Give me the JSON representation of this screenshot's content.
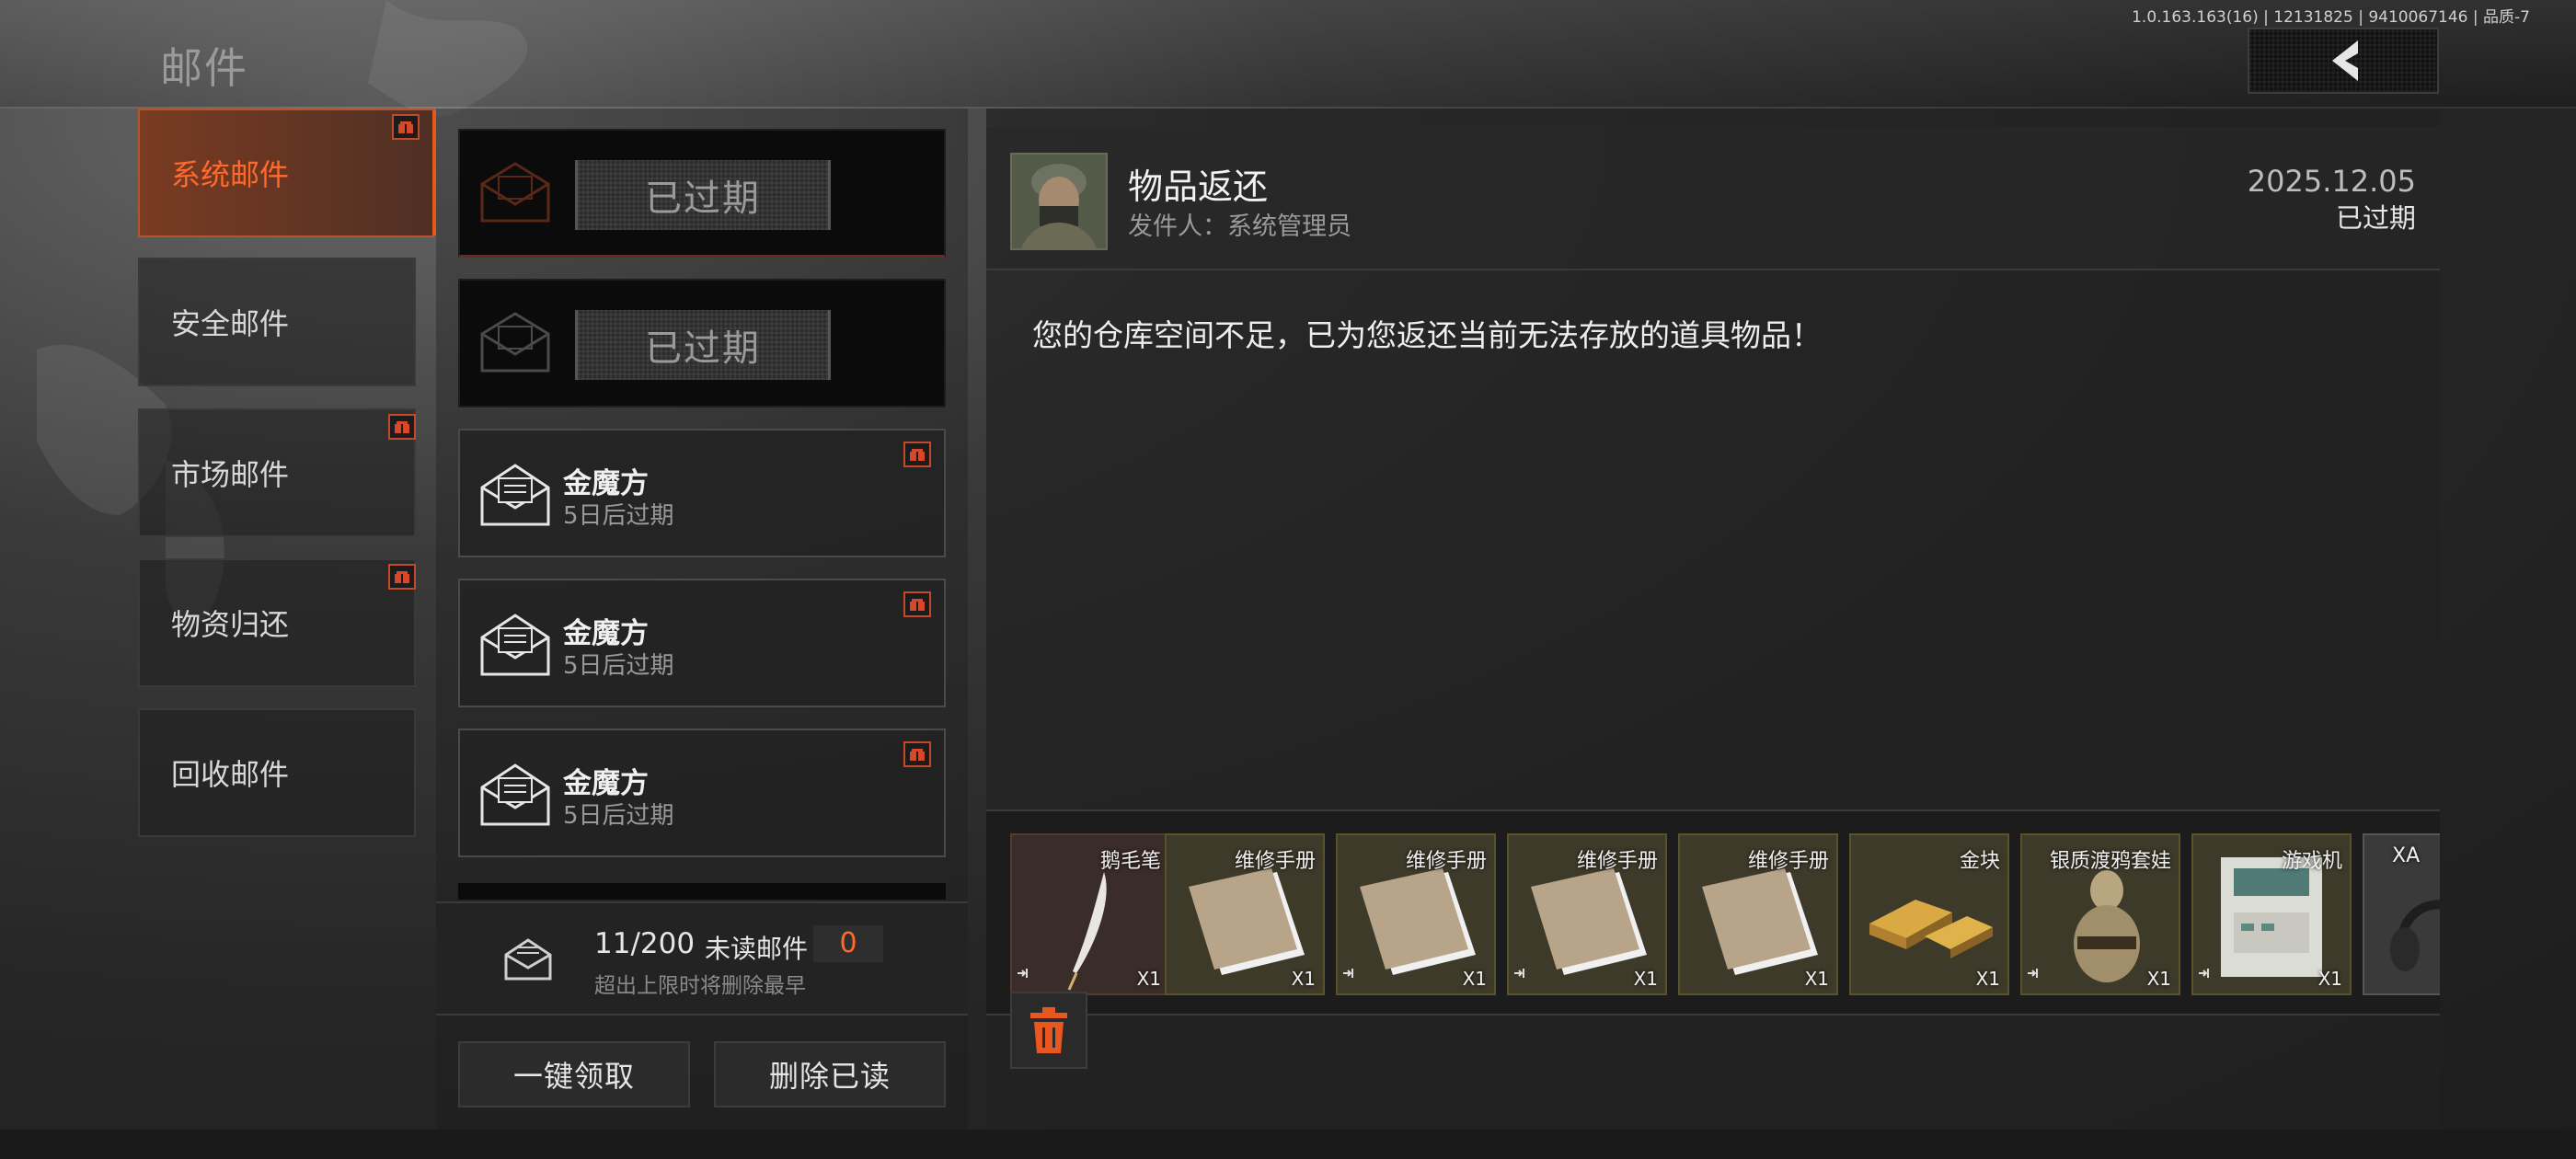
{
  "version_info": "1.0.163.163(16) | 12131825 | 9410067146 | 品质-7",
  "page_title": "邮件",
  "back_button": {
    "icon": "chevron-left-icon"
  },
  "categories": [
    {
      "label": "系统邮件",
      "active": true,
      "has_gift": true
    },
    {
      "label": "安全邮件",
      "active": false,
      "has_gift": false
    },
    {
      "label": "市场邮件",
      "active": false,
      "has_gift": true
    },
    {
      "label": "物资归还",
      "active": false,
      "has_gift": true
    },
    {
      "label": "回收邮件",
      "active": false,
      "has_gift": false
    }
  ],
  "mails": [
    {
      "status_tag": "已过期",
      "selected": true
    },
    {
      "status_tag": "已过期",
      "selected": false
    },
    {
      "title": "金魔方",
      "subtitle": "5日后过期",
      "has_gift": true
    },
    {
      "title": "金魔方",
      "subtitle": "5日后过期",
      "has_gift": true
    },
    {
      "title": "金魔方",
      "subtitle": "5日后过期",
      "has_gift": true
    }
  ],
  "mail_stats": {
    "count": "11/200",
    "unread_label": "未读邮件",
    "unread_count": "0",
    "limit_note": "超出上限时将删除最早"
  },
  "actions": {
    "claim_all": "一键领取",
    "delete_read": "删除已读"
  },
  "detail": {
    "subject": "物品返还",
    "sender": "发件人：系统管理员",
    "date": "2025.12.05",
    "status": "已过期",
    "body": "您的仓库空间不足，已为您返还当前无法存放的道具物品！",
    "items": [
      {
        "name": "鹅毛笔",
        "qty": "X1",
        "icon": "quill-icon"
      },
      {
        "name": "维修手册",
        "qty": "X1",
        "icon": "manual-icon"
      },
      {
        "name": "维修手册",
        "qty": "X1",
        "icon": "manual-icon"
      },
      {
        "name": "维修手册",
        "qty": "X1",
        "icon": "manual-icon"
      },
      {
        "name": "维修手册",
        "qty": "X1",
        "icon": "manual-icon"
      },
      {
        "name": "金块",
        "qty": "X1",
        "icon": "gold-bar-icon"
      },
      {
        "name": "银质渡鸦套娃",
        "qty": "X1",
        "icon": "raven-doll-icon"
      },
      {
        "name": "游戏机",
        "qty": "X1",
        "icon": "arcade-machine-icon"
      },
      {
        "name": "XA",
        "qty": "",
        "icon": "headset-icon"
      }
    ]
  },
  "colors": {
    "accent": "#e8571e",
    "accent_text": "#ff6a2c",
    "gift_border": "#c4492a"
  }
}
